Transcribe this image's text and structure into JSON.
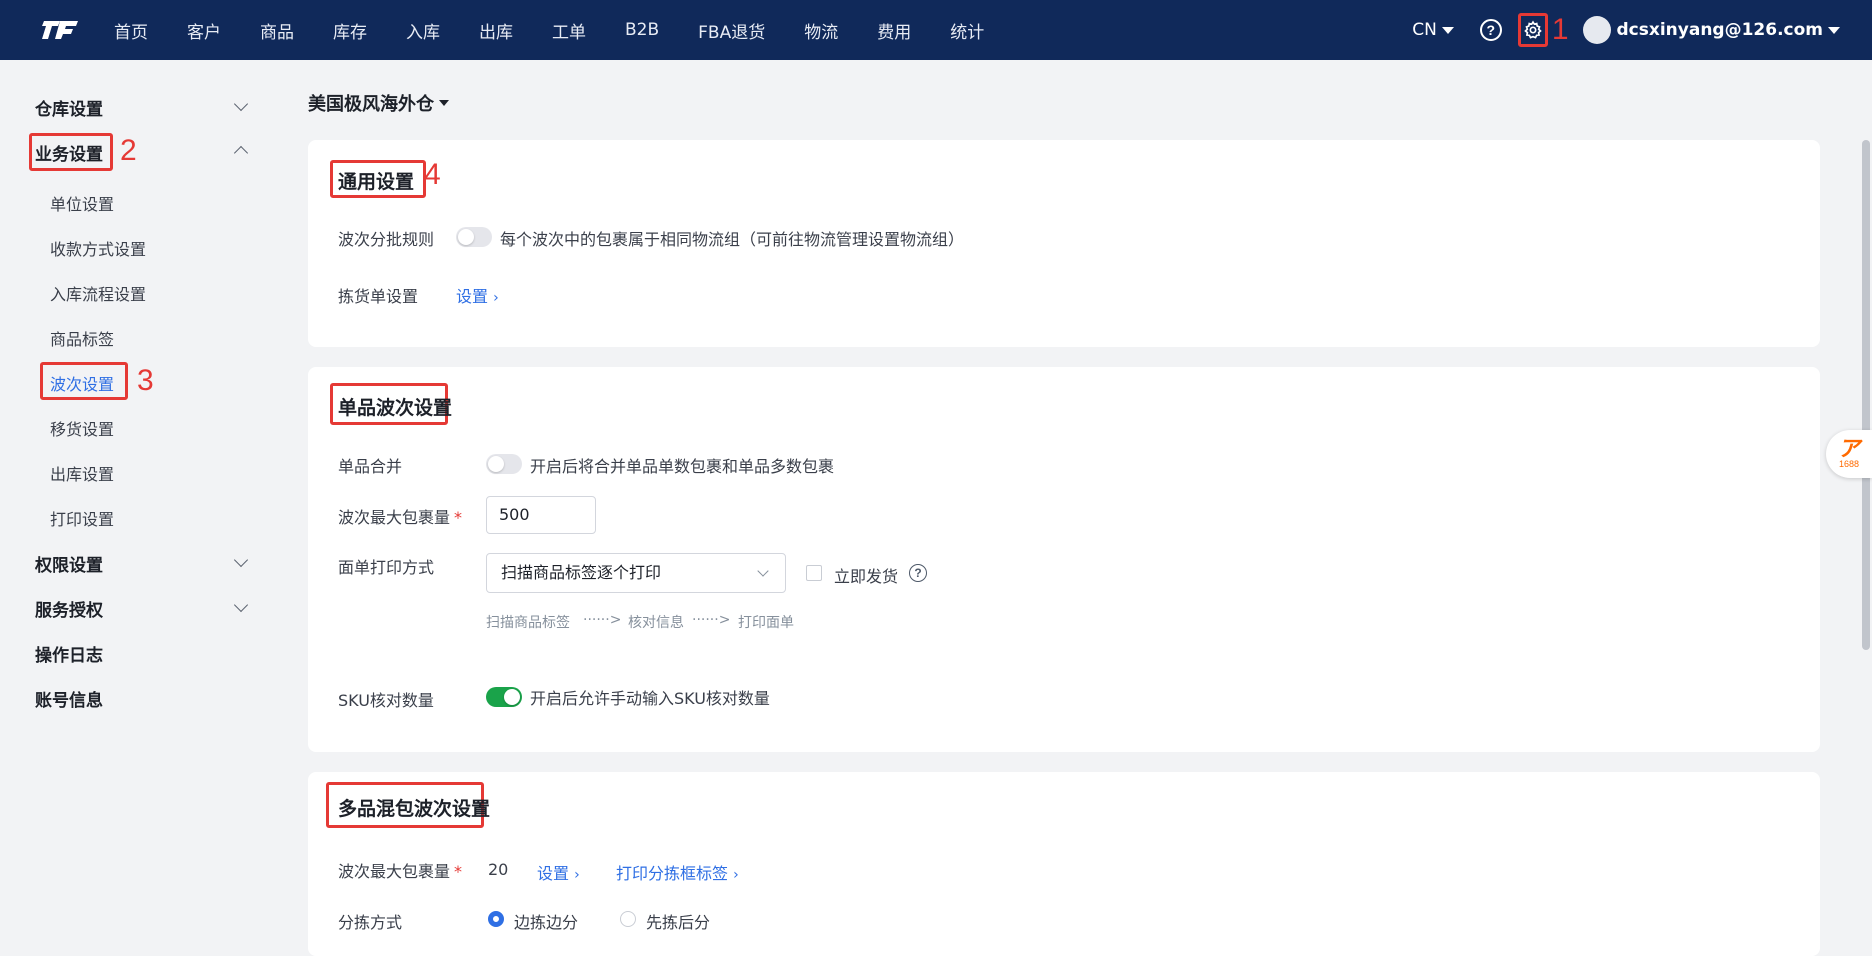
{
  "topbar": {
    "nav": [
      "首页",
      "客户",
      "商品",
      "库存",
      "入库",
      "出库",
      "工单",
      "B2B",
      "FBA退货",
      "物流",
      "费用",
      "统计"
    ],
    "lang": "CN",
    "help_icon": "question-circle-icon",
    "settings_icon": "gear-icon",
    "user_email": "dcsxinyang@126.com"
  },
  "annotations": {
    "a1": "1",
    "a2": "2",
    "a3": "3",
    "a4": "4"
  },
  "sidebar": {
    "warehouse_settings": "仓库设置",
    "business_settings": "业务设置",
    "business_items": [
      "单位设置",
      "收款方式设置",
      "入库流程设置",
      "商品标签",
      "波次设置",
      "移货设置",
      "出库设置",
      "打印设置"
    ],
    "active_item": "波次设置",
    "permission_settings": "权限设置",
    "service_auth": "服务授权",
    "operation_log": "操作日志",
    "account_info": "账号信息"
  },
  "main": {
    "warehouse": "美国极风海外仓",
    "general": {
      "title": "通用设置",
      "wave_batch_label": "波次分批规则",
      "wave_batch_desc": "每个波次中的包裹属于相同物流组（可前往物流管理设置物流组）",
      "wave_batch_on": false,
      "picking_label": "拣货单设置",
      "picking_link": "设置"
    },
    "single": {
      "title": "单品波次设置",
      "merge_label": "单品合并",
      "merge_desc": "开启后将合并单品单数包裹和单品多数包裹",
      "merge_on": false,
      "max_label": "波次最大包裹量",
      "required_mark": "*",
      "max_value": "500",
      "print_label": "面单打印方式",
      "print_value": "扫描商品标签逐个打印",
      "ship_now_label": "立即发货",
      "ship_now_checked": false,
      "flow_steps": [
        "扫描商品标签",
        "核对信息",
        "打印面单"
      ],
      "flow_arrow": "······>",
      "sku_label": "SKU核对数量",
      "sku_desc": "开启后允许手动输入SKU核对数量",
      "sku_on": true
    },
    "multi": {
      "title": "多品混包波次设置",
      "max_label": "波次最大包裹量",
      "required_mark": "*",
      "max_value": "20",
      "set_link": "设置",
      "print_link": "打印分拣框标签",
      "sort_label": "分拣方式",
      "sort_options": [
        "边拣边分",
        "先拣后分"
      ],
      "sort_selected": "边拣边分"
    }
  },
  "float_badge": {
    "text": "1688"
  },
  "colors": {
    "nav_bg": "#10295a",
    "accent": "#2f6fe4",
    "annotation": "#e53935",
    "toggle_on": "#1aa34a"
  }
}
